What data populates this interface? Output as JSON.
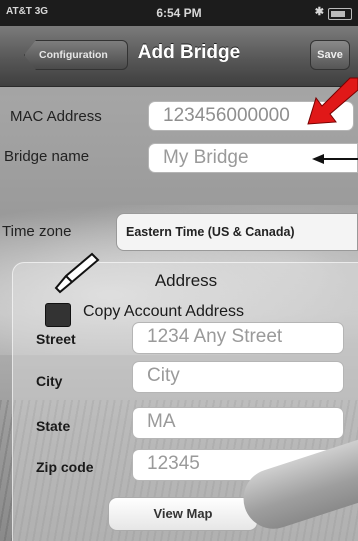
{
  "status_bar": {
    "carrier": "AT&T 3G",
    "time": "6:54 PM"
  },
  "nav": {
    "back_label": "Configuration",
    "title": "Add Bridge",
    "save_label": "Save"
  },
  "form": {
    "mac_label": "MAC Address",
    "mac_value": "123456000000",
    "bridge_name_label": "Bridge name",
    "bridge_name_value": "My Bridge",
    "time_zone_label": "Time zone",
    "time_zone_value": "Eastern Time (US & Canada)"
  },
  "address": {
    "title": "Address",
    "copy_label": "Copy Account Address",
    "street_label": "Street",
    "street_value": "1234 Any Street",
    "city_label": "City",
    "city_value": "City",
    "state_label": "State",
    "state_value": "MA",
    "zip_label": "Zip code",
    "zip_value": "12345"
  },
  "view_map_label": "View Map",
  "colors": {
    "annotation_arrow": "#e01818",
    "nav_bar": "#575757"
  }
}
